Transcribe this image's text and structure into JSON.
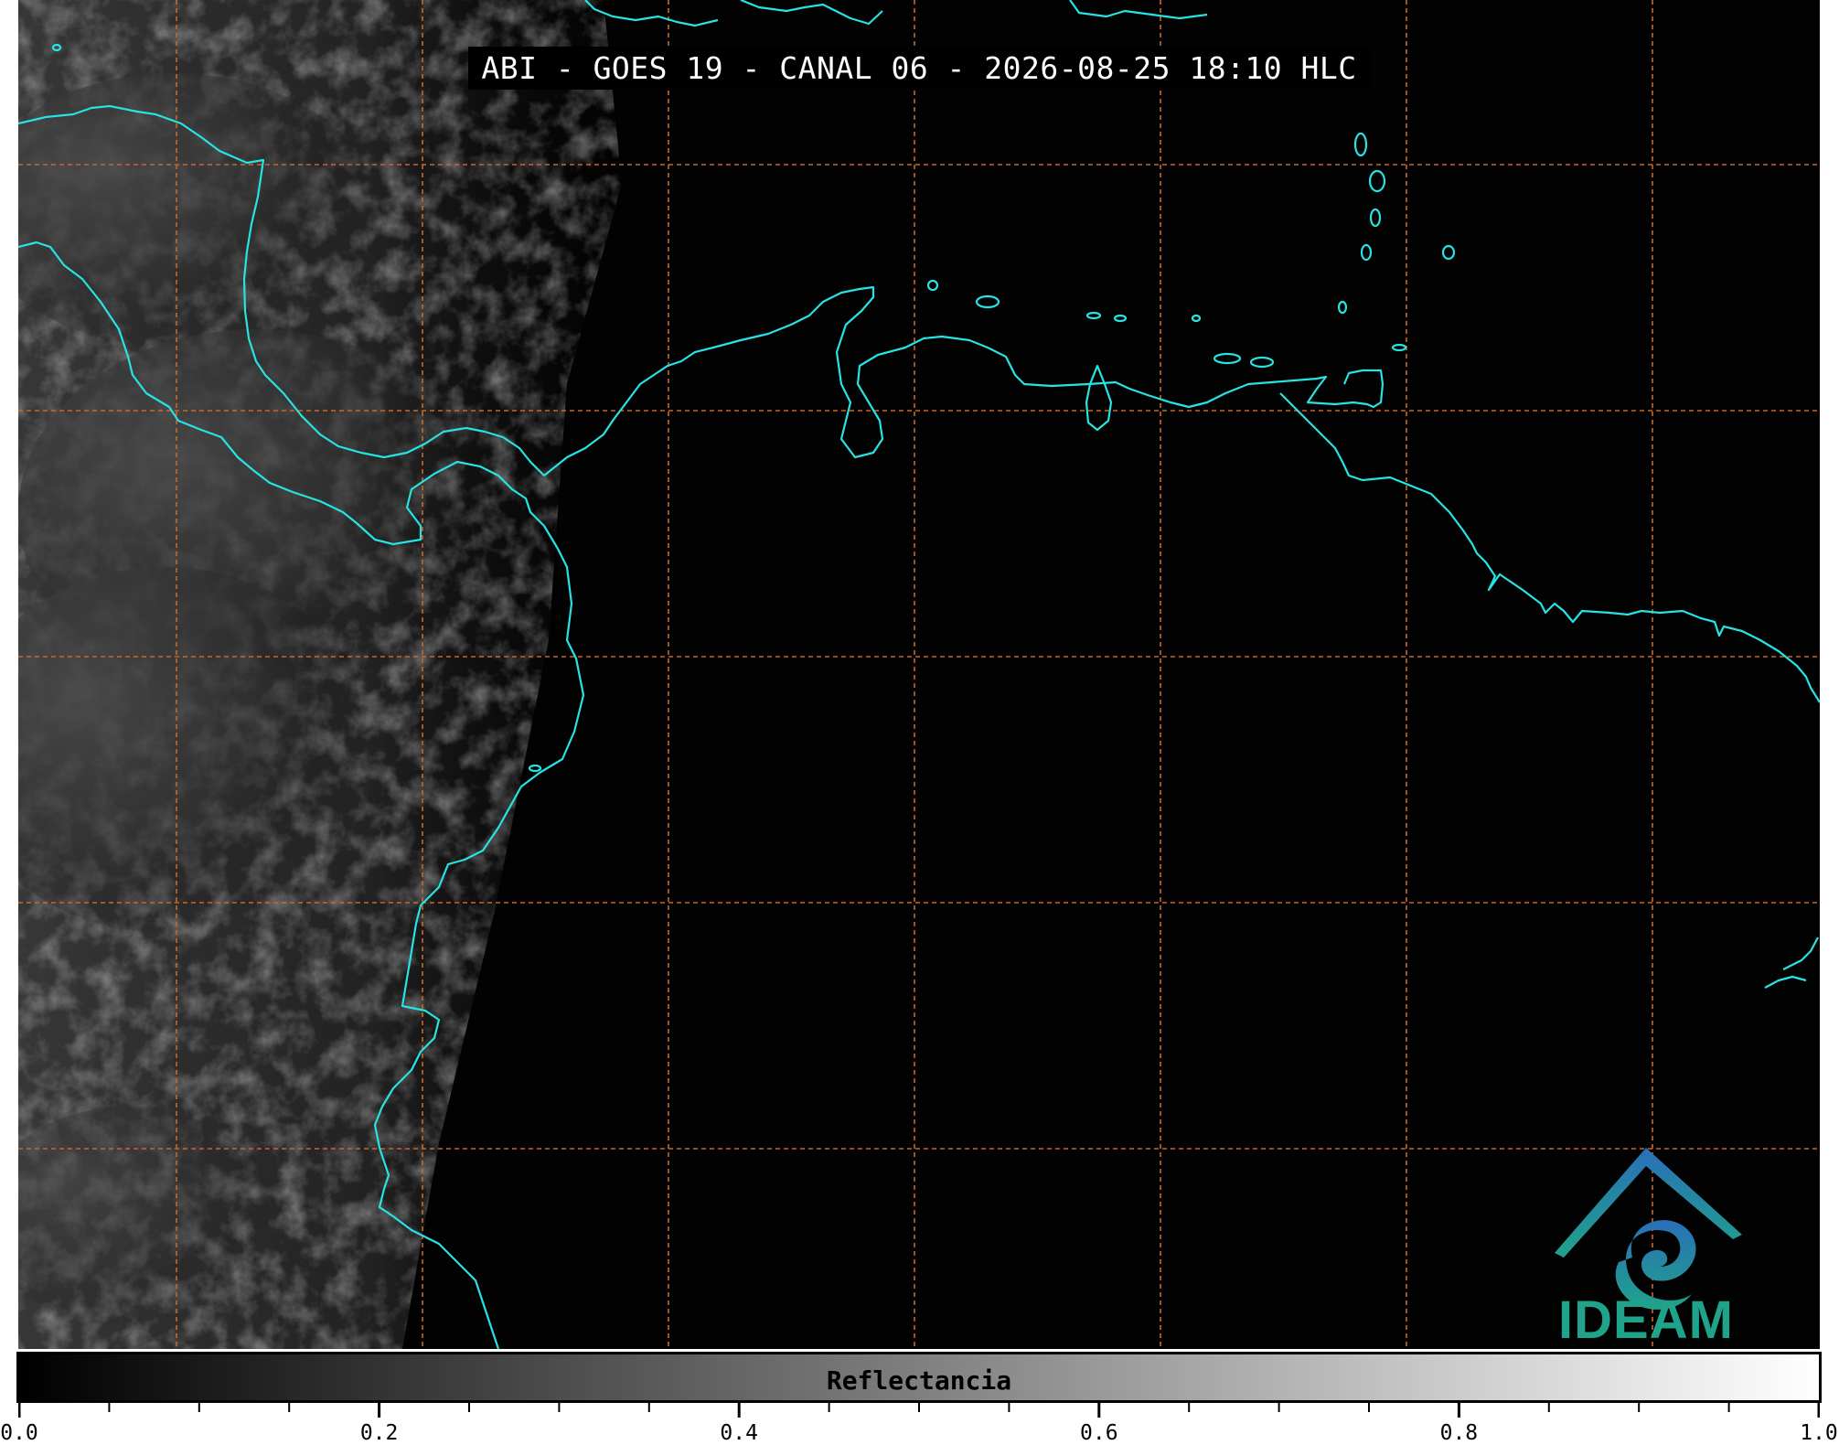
{
  "title": "ABI - GOES 19 - CANAL 06 - 2026-08-25 18:10 HLC",
  "logo": {
    "text": "IDEAM",
    "icon": "ideam-logo-icon"
  },
  "colorbar": {
    "label": "Reflectancia",
    "range": [
      0.0,
      1.0
    ],
    "tick_labels": [
      "0.0",
      "0.2",
      "0.4",
      "0.6",
      "0.8",
      "1.0"
    ],
    "colormap": "grayscale"
  },
  "map": {
    "coastline_color": "#27e3e3",
    "gridline_color": "#c8682a",
    "gridlines": "dashed"
  }
}
